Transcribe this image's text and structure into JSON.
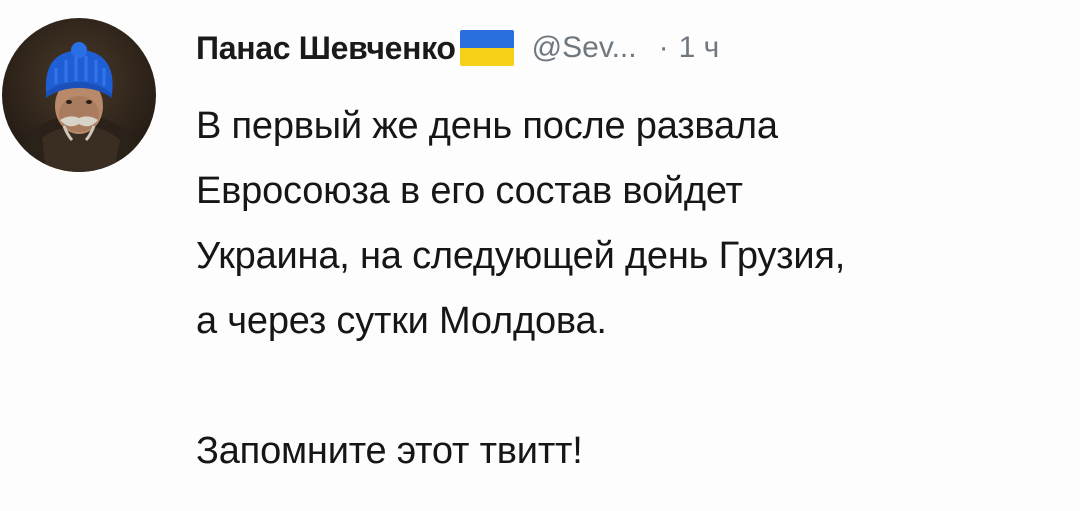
{
  "tweet": {
    "author": {
      "display_name": "Панас Шевченко",
      "handle": "@Sev...",
      "flag_icon": "ukraine-flag-icon",
      "avatar_icon": "avatar-portrait-icon"
    },
    "separator": "·",
    "time": "1 ч",
    "text": {
      "line1": "В первый же день после развала",
      "line2": "Евросоюза в его состав войдет",
      "line3": "Украина, на следующей день Грузия,",
      "line4": "а через сутки Молдова.",
      "line5": "Запомните этот твитт!"
    }
  },
  "colors": {
    "background": "#fdfdfd",
    "text": "#161616",
    "secondary_text": "#6f7880",
    "flag_blue": "#2a6fe0",
    "flag_yellow": "#f7d117"
  }
}
